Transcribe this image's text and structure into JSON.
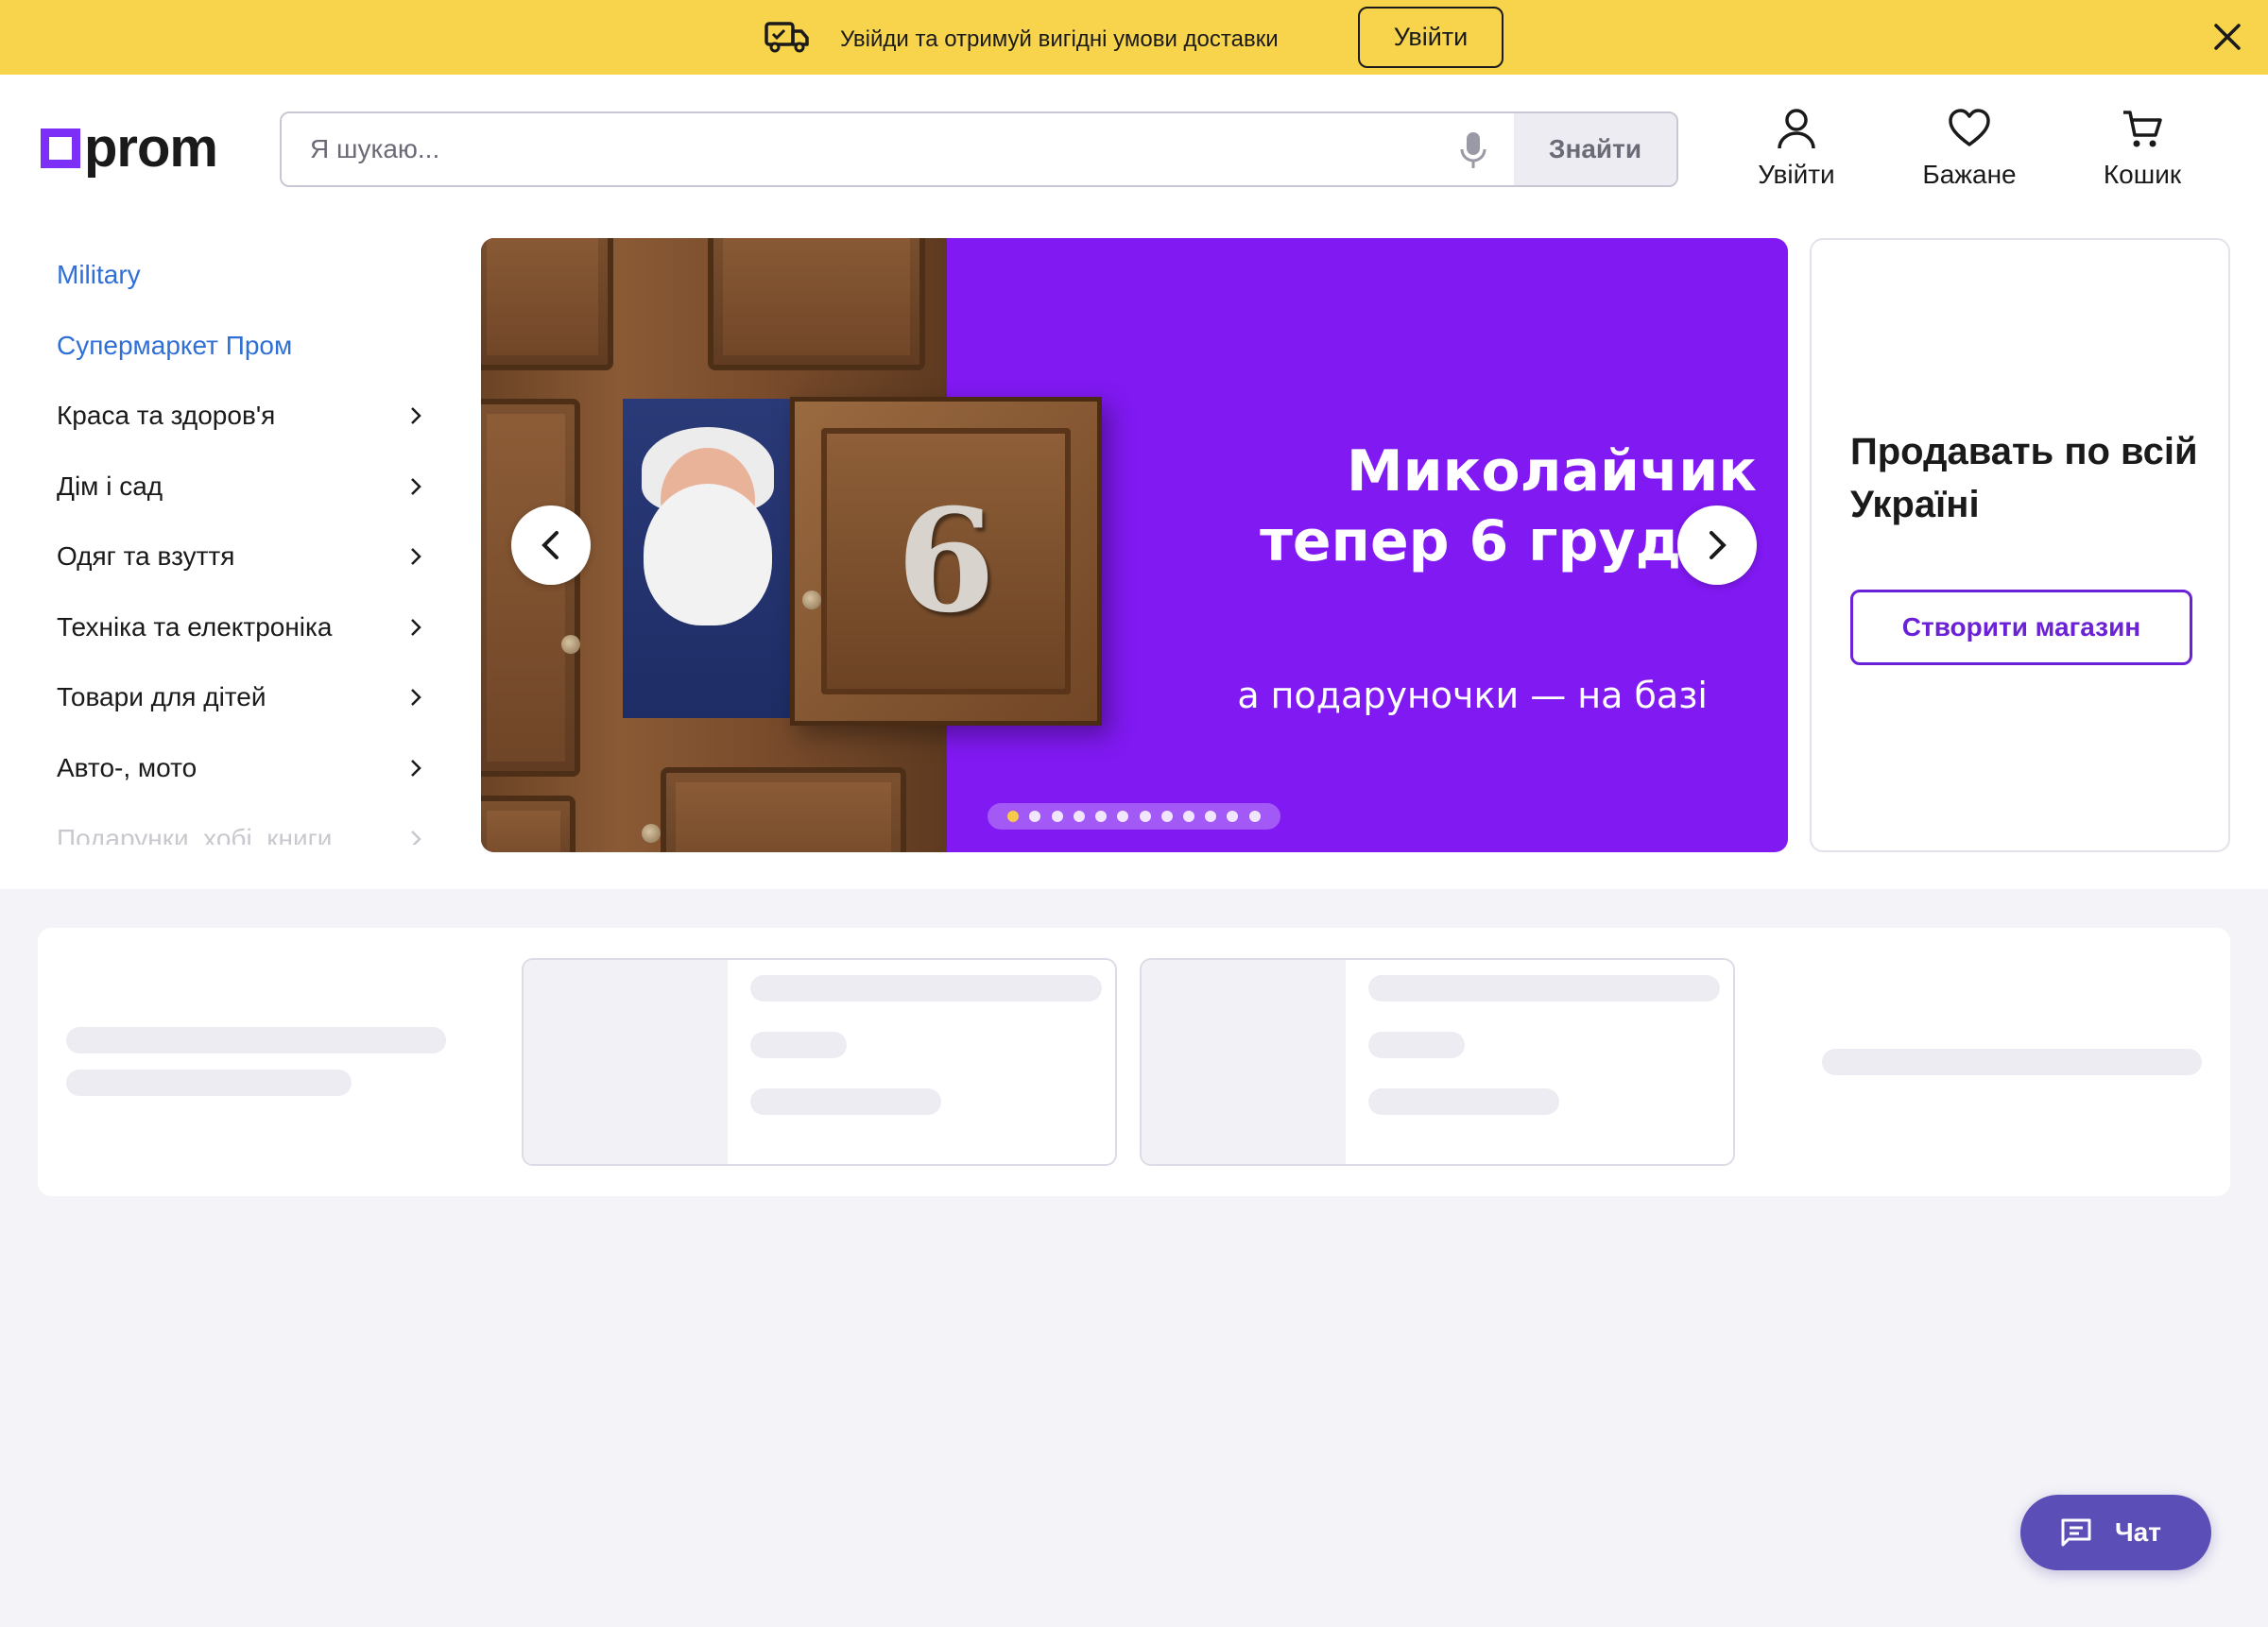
{
  "promo": {
    "text": "Увійди та отримуй вигідні умови доставки",
    "login_label": "Увійти",
    "truck_icon": "delivery-truck-icon",
    "close_icon": "close-icon"
  },
  "header": {
    "logo_text": "prom",
    "search": {
      "placeholder": "Я шукаю...",
      "button_label": "Знайти"
    },
    "actions": [
      {
        "label": "Увійти",
        "icon": "user-icon"
      },
      {
        "label": "Бажане",
        "icon": "heart-icon"
      },
      {
        "label": "Кошик",
        "icon": "cart-icon"
      }
    ]
  },
  "sidebar": {
    "items": [
      {
        "label": "Military",
        "style": "link"
      },
      {
        "label": "Супермаркет Пром",
        "style": "link"
      },
      {
        "label": "Краса та здоров'я",
        "has_submenu": true
      },
      {
        "label": "Дім і сад",
        "has_submenu": true
      },
      {
        "label": "Одяг та взуття",
        "has_submenu": true
      },
      {
        "label": "Техніка та електроніка",
        "has_submenu": true
      },
      {
        "label": "Товари для дітей",
        "has_submenu": true
      },
      {
        "label": "Авто-, мото",
        "has_submenu": true
      },
      {
        "label": "Подарунки, хобі, книги",
        "has_submenu": true
      }
    ]
  },
  "banner": {
    "title_line1": "Миколайчик",
    "title_line2": "тепер 6 грудня",
    "subtitle": "а подаруночки — на базі",
    "door_number": "6",
    "slide_count": 12,
    "active_slide": 1,
    "background_color": "#8019f2"
  },
  "seller": {
    "title": "Продавать по всій Україні",
    "button_label": "Створити магазин"
  },
  "chat": {
    "label": "Чат",
    "icon": "chat-icon"
  },
  "colors": {
    "promo_bg": "#f7d44c",
    "brand_purple": "#7b2ff7",
    "link_blue": "#2f6fd6",
    "chat_bg": "#5b4eb6"
  }
}
